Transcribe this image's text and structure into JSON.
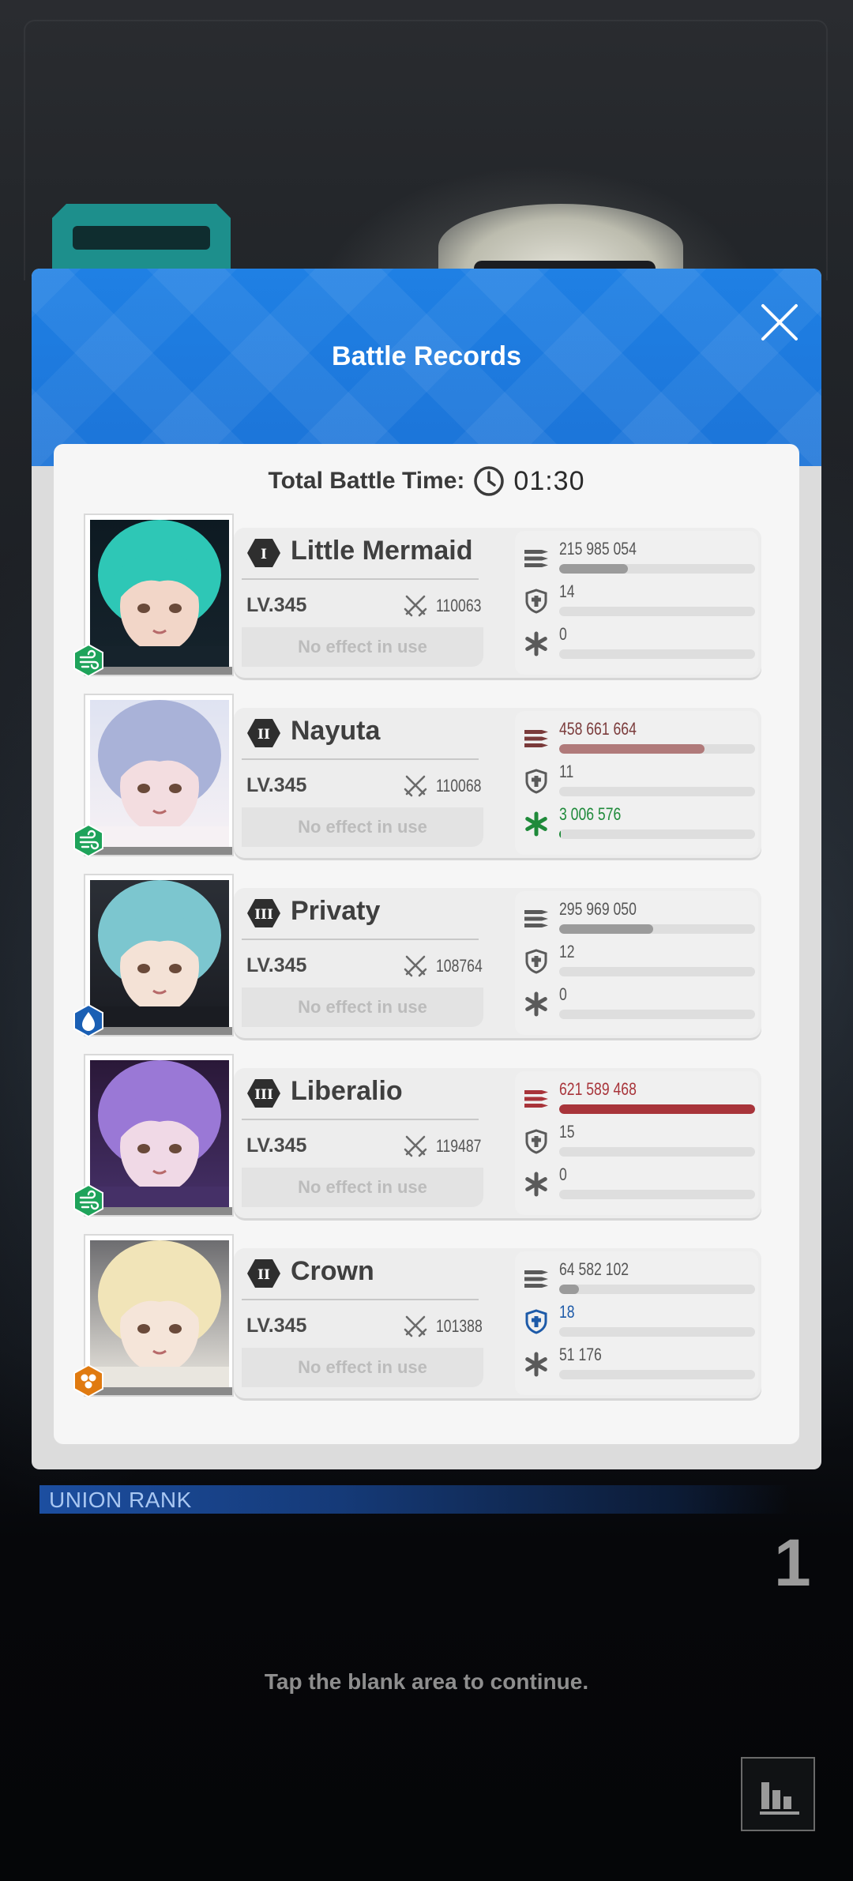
{
  "modal": {
    "title": "Battle Records",
    "total_label": "Total Battle Time:",
    "total_time": "01:30"
  },
  "records": [
    {
      "rank": "I",
      "name": "Little Mermaid",
      "level": "LV.345",
      "power": "110063",
      "effect": "No effect in use",
      "element": "wind",
      "damage": "215 985 054",
      "damage_fraction": 0.35,
      "shield": "14",
      "shield_fraction": 0,
      "heal": "0",
      "heal_fraction": 0,
      "highlight": "none"
    },
    {
      "rank": "II",
      "name": "Nayuta",
      "level": "LV.345",
      "power": "110068",
      "effect": "No effect in use",
      "element": "wind",
      "damage": "458 661 664",
      "damage_fraction": 0.74,
      "shield": "11",
      "shield_fraction": 0,
      "heal": "3 006 576",
      "heal_fraction": 0.01,
      "highlight": "heal"
    },
    {
      "rank": "III",
      "name": "Privaty",
      "level": "LV.345",
      "power": "108764",
      "effect": "No effect in use",
      "element": "water",
      "damage": "295 969 050",
      "damage_fraction": 0.48,
      "shield": "12",
      "shield_fraction": 0,
      "heal": "0",
      "heal_fraction": 0,
      "highlight": "none"
    },
    {
      "rank": "III",
      "name": "Liberalio",
      "level": "LV.345",
      "power": "119487",
      "effect": "No effect in use",
      "element": "wind",
      "damage": "621 589 468",
      "damage_fraction": 1.0,
      "shield": "15",
      "shield_fraction": 0,
      "heal": "0",
      "heal_fraction": 0,
      "highlight": "damage"
    },
    {
      "rank": "II",
      "name": "Crown",
      "level": "LV.345",
      "power": "101388",
      "effect": "No effect in use",
      "element": "iron",
      "damage": "64 582 102",
      "damage_fraction": 0.1,
      "shield": "18",
      "shield_fraction": 0,
      "heal": "51 176",
      "heal_fraction": 0,
      "highlight": "shield"
    }
  ],
  "union": {
    "label": "UNION RANK",
    "rank": "1"
  },
  "hint": "Tap the blank area to continue.",
  "colors": {
    "header_blue": "#1f7de3",
    "damage_gray": "#9b9b9b",
    "damage_pink": "#b07a7a",
    "damage_red": "#a8343a",
    "heal_green": "#1f8a3a",
    "shield_blue": "#1d5aa8",
    "wind_green": "#1ea35a",
    "water_blue": "#1a5fb4",
    "iron_orange": "#e07a10"
  }
}
